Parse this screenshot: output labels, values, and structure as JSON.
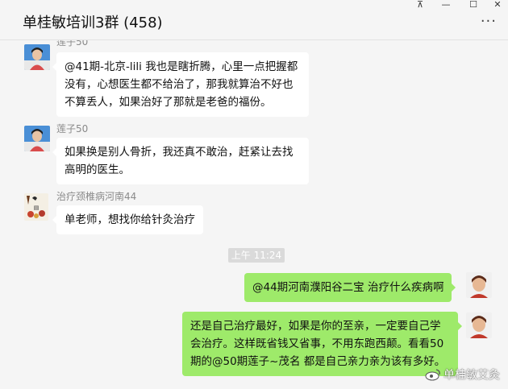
{
  "window": {
    "title": "单桂敏培训3群 (458)",
    "pin_glyph": "⊼",
    "minimize_glyph": "—",
    "maximize_glyph": "☐",
    "close_glyph": "✕",
    "more_glyph": "···"
  },
  "messages": [
    {
      "side": "in",
      "sender": "莲子50",
      "avatar": "person-avatar-icon",
      "text": "@41期-北京-lili 我也是瞎折腾，心里一点把握都没有，心想医生都不给治了，那我就算治不好也不算丢人，如果治好了那就是老爸的福份。"
    },
    {
      "side": "in",
      "sender": "莲子50",
      "avatar": "person-avatar-icon",
      "text": "如果换是别人骨折，我还真不敢治，赶紧让去找高明的医生。"
    },
    {
      "side": "in",
      "sender": "治疗颈椎病河南44",
      "avatar": "painting-avatar-icon",
      "text": "单老师，想找你给针灸治疗"
    },
    {
      "side": "out",
      "avatar": "self-avatar-icon",
      "text": "@44期河南濮阳谷二宝 治疗什么疾病啊"
    },
    {
      "side": "out",
      "avatar": "self-avatar-icon",
      "text": "还是自己治疗最好，如果是你的至亲，一定要自己学会治疗。这样既省钱又省事，不用东跑西颠。看看50期的@50期莲子~茂名 都是自己亲力亲为该有多好。"
    }
  ],
  "timestamp": "上午 11:24",
  "watermark": "单桂敏艾灸",
  "colors": {
    "outgoing_bubble": "#9eea6a",
    "incoming_bubble": "#ffffff",
    "background": "#f5f5f5"
  }
}
